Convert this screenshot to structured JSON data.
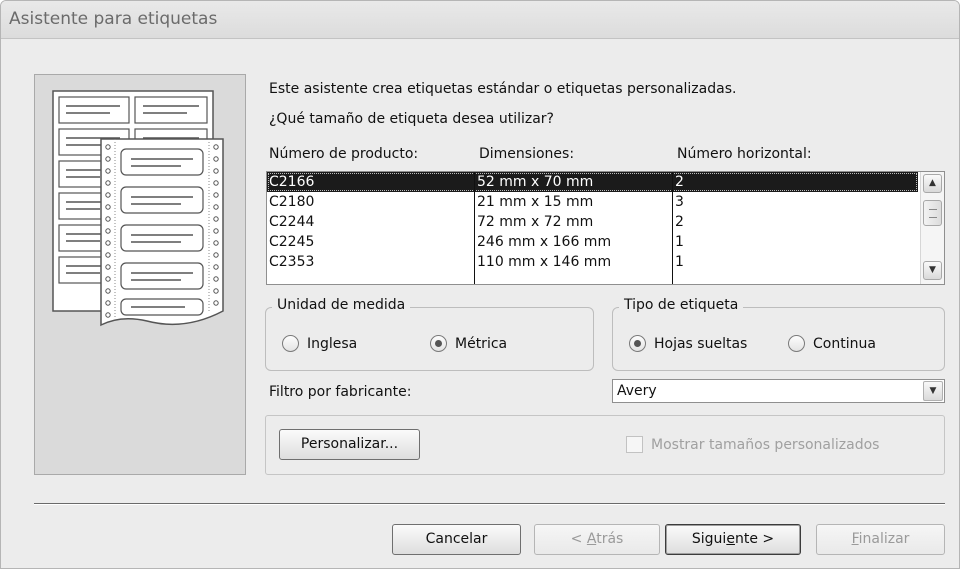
{
  "window": {
    "title": "Asistente para etiquetas"
  },
  "intro_text": "Este asistente crea etiquetas estándar o etiquetas personalizadas.",
  "question_text": "¿Qué tamaño de etiqueta desea utilizar?",
  "columns": {
    "product": "Número de producto:",
    "dimensions": "Dimensiones:",
    "horizontal": "Número horizontal:"
  },
  "labels_list": [
    {
      "product": "C2166",
      "dimensions": "52 mm x 70 mm",
      "horizontal": "2",
      "selected": true
    },
    {
      "product": "C2180",
      "dimensions": "21 mm x 15 mm",
      "horizontal": "3",
      "selected": false
    },
    {
      "product": "C2244",
      "dimensions": "72 mm x 72 mm",
      "horizontal": "2",
      "selected": false
    },
    {
      "product": "C2245",
      "dimensions": "246 mm x 166 mm",
      "horizontal": "1",
      "selected": false
    },
    {
      "product": "C2353",
      "dimensions": "110 mm x 146 mm",
      "horizontal": "1",
      "selected": false
    }
  ],
  "units": {
    "legend": "Unidad de medida",
    "options": [
      {
        "label": "Inglesa",
        "checked": false
      },
      {
        "label": "Métrica",
        "checked": true
      }
    ]
  },
  "label_type": {
    "legend": "Tipo de etiqueta",
    "options": [
      {
        "label": "Hojas sueltas",
        "checked": true
      },
      {
        "label": "Continua",
        "checked": false
      }
    ]
  },
  "filter": {
    "label": "Filtro por fabricante:",
    "value": "Avery"
  },
  "custom": {
    "button": "Personalizar...",
    "checkbox_label": "Mostrar tamaños personalizados",
    "checkbox_checked": false,
    "checkbox_enabled": false
  },
  "buttons": {
    "cancel": "Cancelar",
    "back_prefix": "< ",
    "back_access": "A",
    "back_rest": "trás",
    "next_prefix": "Sigui",
    "next_access": "e",
    "next_rest": "nte >",
    "finish_access": "F",
    "finish_rest": "inalizar"
  },
  "colors": {
    "selection": "#1b1b1b",
    "dialog_bg": "#ececec",
    "disabled_text": "#9a9a9a"
  }
}
